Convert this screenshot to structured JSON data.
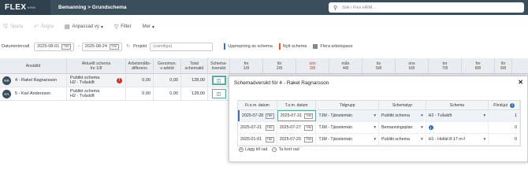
{
  "app": {
    "logo": "FLEX",
    "logo_sup": "HRM",
    "breadcrumb": "Bemanning > Grundschema"
  },
  "search": {
    "placeholder": "Sök i Flex HRM..."
  },
  "toolbar": {
    "save": "Spara",
    "undo": "Ångra",
    "adapted_view": "Anpassad vy",
    "filter": "Filter",
    "more": "Mer"
  },
  "filters": {
    "interval_label": "Datumintervall",
    "from": "2025-08-01",
    "to": "2025-08-24",
    "project_label": "Projekt",
    "project_placeholder": "(samtliga)",
    "legend": [
      {
        "label": "Upprepning av schema",
        "color": "#3b6fb6"
      },
      {
        "label": "Nytt schema",
        "color": "#e05a2b"
      },
      {
        "label": "Flera arbetspass",
        "color": "#888888"
      }
    ]
  },
  "table": {
    "headers": [
      {
        "l1": "Anställd",
        "l2": ""
      },
      {
        "l1": "Aktuellt schema",
        "l2": "fre 1/8"
      },
      {
        "l1": "Arbetsmålts-",
        "l2": "differens"
      },
      {
        "l1": "Genomsn.",
        "l2": "v-arbtid"
      },
      {
        "l1": "Total",
        "l2": "schematid"
      },
      {
        "l1": "Schema-",
        "l2": "översikt"
      },
      {
        "l1": "fre",
        "l2": "1/8"
      },
      {
        "l1": "lör",
        "l2": "2/8"
      },
      {
        "l1": "sön",
        "l2": "3/8"
      },
      {
        "l1": "mån",
        "l2": "4/8"
      },
      {
        "l1": "tis",
        "l2": "5/8"
      },
      {
        "l1": "ons",
        "l2": "6/8"
      },
      {
        "l1": "tor",
        "l2": "7/8"
      },
      {
        "l1": "fre",
        "l2": "8/8"
      },
      {
        "l1": "lör",
        "l2": "9/8"
      }
    ],
    "rows": [
      {
        "initials": "RR",
        "name": "4 - Rakel Ragnarsson",
        "schema1": "Publikt schema",
        "schema2": "H2 - Tvåskift",
        "diff": "0,00",
        "avg": "0,00",
        "total": "128,00"
      },
      {
        "initials": "KA",
        "name": "5 - Karl Andersson",
        "schema1": "Publikt schema",
        "schema2": "H2 - Tvåskift",
        "diff": "0,00",
        "avg": "0,00",
        "total": "128,00"
      }
    ]
  },
  "overlay": {
    "title": "Schemaöversikt för 4 - Rakel Ragnarsson",
    "headers": [
      "Fr.o.m. datum",
      "T.o.m. datum",
      "Tidgrupp",
      "Schematyp",
      "Schema",
      "Förskjut"
    ],
    "rows": [
      {
        "from": "2025-07-28",
        "to": "2025-07-31",
        "group": "TJM - Tjänstemän",
        "type": "Publikt schema",
        "schema": "H2 - Tvåskift",
        "shift": "1"
      },
      {
        "from": "2025-07-21",
        "to": "2025-07-27",
        "group": "TJM - Tjänstemän",
        "type": "Bemanningsplan",
        "schema": "",
        "shift": "0"
      },
      {
        "from": "2025-01-01",
        "to": "2025-07-20",
        "group": "TJM - Tjänstemän",
        "type": "Publikt schema",
        "schema": "H1 - Heltid 8-17 m-f",
        "shift": "0"
      }
    ],
    "add_row": "Lägg till rad",
    "remove_row": "Ta bort rad"
  },
  "colors": {
    "topbar": "#3b4e5c",
    "accent": "#5aa8a8",
    "sunday": "#c0392b"
  }
}
